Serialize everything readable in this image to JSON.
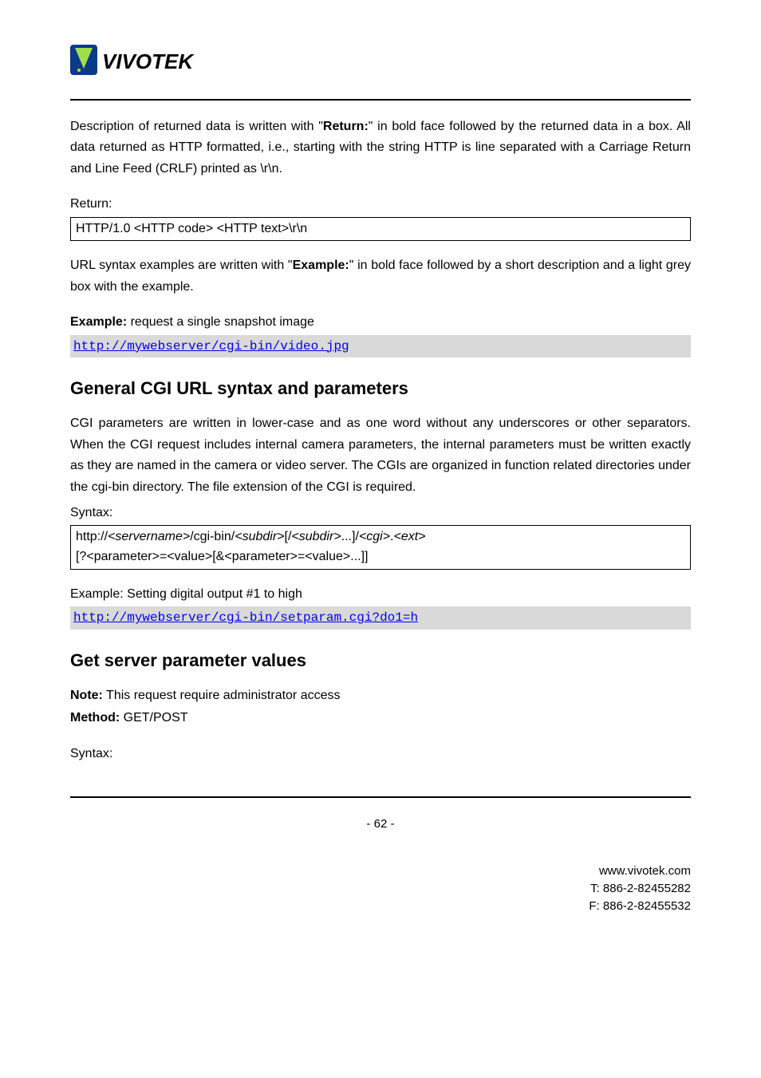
{
  "logo": {
    "text": "VIVOTEK"
  },
  "para1": "Description of returned data is written with \"",
  "para1_bold": "Return:",
  "para1_after": "\" in bold face followed by the returned data in a box. All data returned as HTTP formatted, i.e., starting with the string HTTP is line separated with a Carriage Return and Line Feed (CRLF) printed as \\r\\n.",
  "return_label": "Return:",
  "return_box": "HTTP/1.0 <HTTP code> <HTTP text>\\r\\n",
  "para2_a": "URL syntax examples are written with \"",
  "para2_bold": "Example:",
  "para2_b": "\" in bold face followed by a short description and a light grey box with the example.",
  "example_label": "Example:",
  "example_desc": " request a single snapshot image",
  "example_url": "http://mywebserver/cgi-bin/video.jpg",
  "heading1": "General CGI URL syntax and parameters",
  "cgi_para": "CGI parameters are written in lower-case and as one word without any underscores or other separators. When the CGI request includes internal camera parameters, the internal parameters must be written exactly as they are named in the camera or video server. The CGIs are organized in function related directories under the cgi-bin directory. The file extension of the CGI is required.",
  "syntax_label": "Syntax:",
  "syntax_box_l1_a": "http://",
  "syntax_box_l1_b": "<servername>",
  "syntax_box_l1_c": "/cgi-bin/",
  "syntax_box_l1_d": "<subdir>",
  "syntax_box_l1_e": "[/",
  "syntax_box_l1_f": "<subdir>",
  "syntax_box_l1_g": "...]/",
  "syntax_box_l1_h": "<cgi>",
  "syntax_box_l1_i": ".",
  "syntax_box_l1_j": "<ext>",
  "syntax_box_l2": "[?<parameter>=<value>[&<parameter>=<value>...]]",
  "example2_label": "Example: Setting digital output #1 to high",
  "example2_url": "http://mywebserver/cgi-bin/setparam.cgi?do1=h",
  "heading2": "Get server parameter values",
  "note_bold": "Note:",
  "note_text": " This request require administrator access",
  "method_bold": "Method:",
  "method_text": " GET/POST",
  "syntax_label2": "Syntax:",
  "page_number": "- 62 -",
  "footer": {
    "url": "www.vivotek.com",
    "tel": "T: 886-2-82455282",
    "fax": "F: 886-2-82455532"
  }
}
